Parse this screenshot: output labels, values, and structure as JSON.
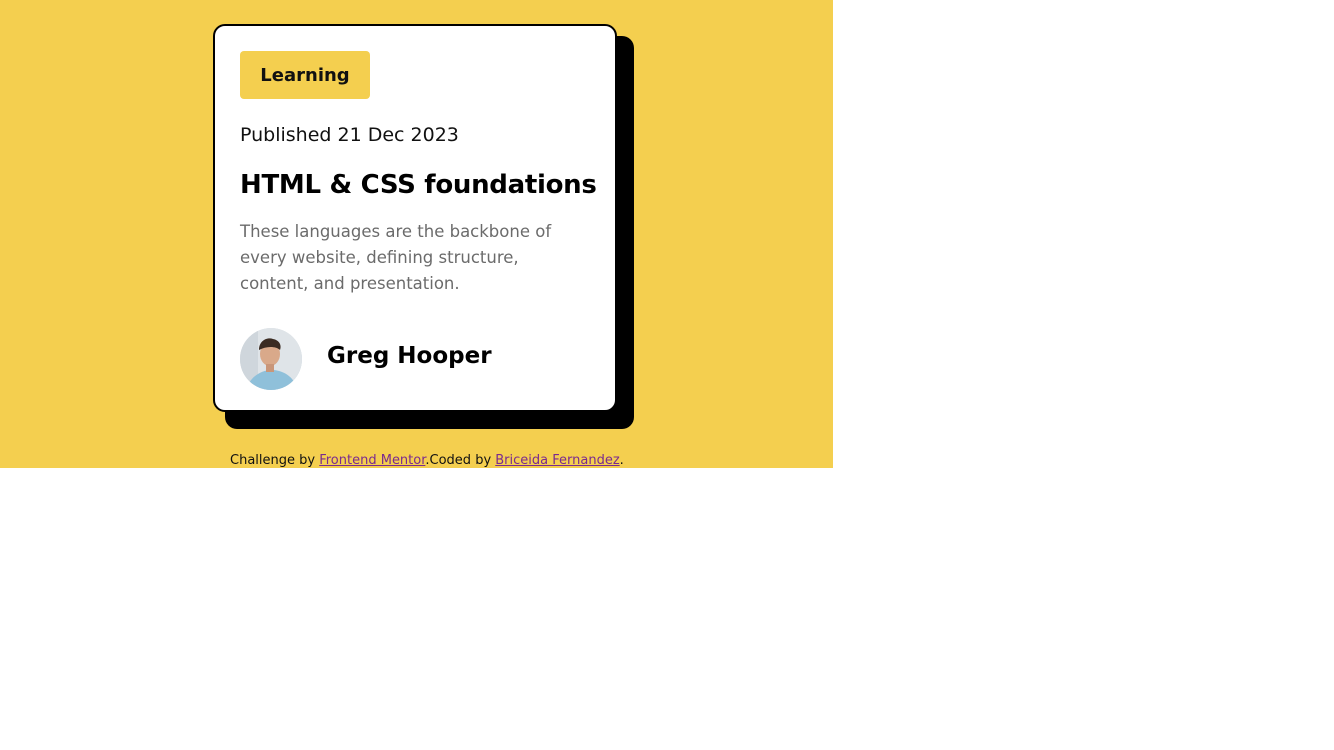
{
  "card": {
    "tag": "Learning",
    "published": "Published 21 Dec 2023",
    "title": "HTML & CSS foundations",
    "description": "These languages are the backbone of every website, defining structure, content, and presentation.",
    "author": "Greg Hooper"
  },
  "attribution": {
    "prefix": "Challenge by ",
    "link1": "Frontend Mentor",
    "middle": ".Coded by ",
    "link2": "Briceida Fernandez",
    "suffix": "."
  },
  "colors": {
    "background": "#F4CF4F",
    "card": "#FFFFFF",
    "text": "#000000",
    "muted": "#6B6B6B"
  },
  "icons": {
    "avatar": "avatar-icon"
  }
}
